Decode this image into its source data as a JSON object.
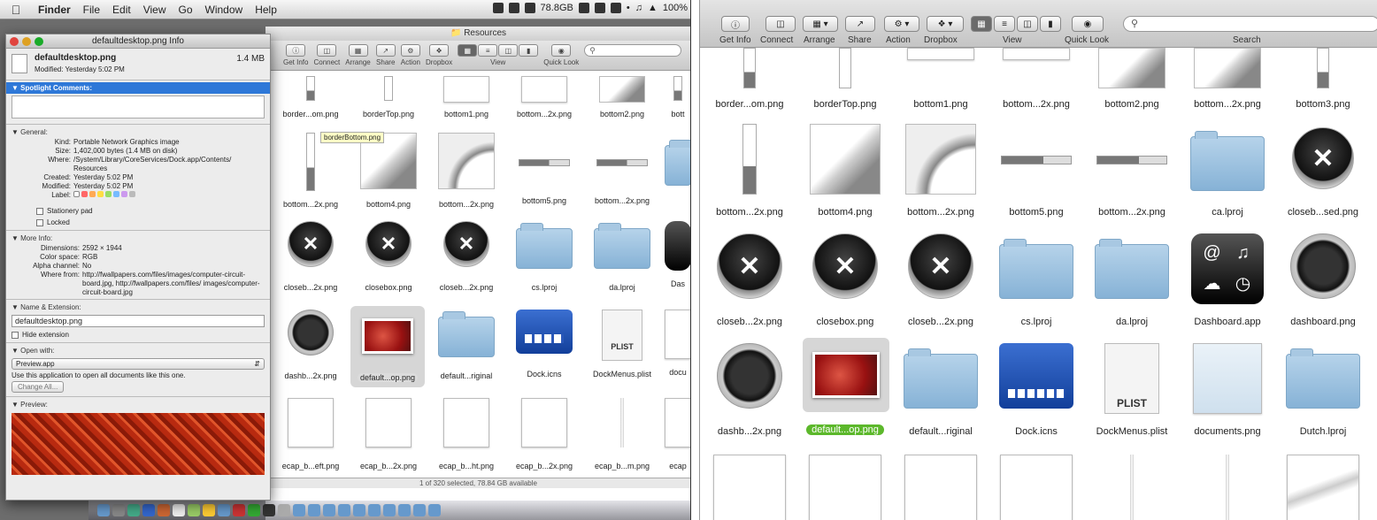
{
  "menubar": {
    "app": "Finder",
    "items": [
      "File",
      "Edit",
      "View",
      "Go",
      "Window",
      "Help"
    ],
    "disk": "78.8GB",
    "battery": "100%"
  },
  "finder": {
    "title": "Resources",
    "toolbar": [
      "Get Info",
      "Connect",
      "Arrange",
      "Share",
      "Action",
      "Dropbox",
      "View",
      "Quick Look"
    ],
    "status": "1 of 320 selected, 78.84 GB available",
    "tooltip": "borderBottom.png",
    "items": [
      [
        "border...om.png",
        "borderTop.png",
        "bottom1.png",
        "bottom...2x.png",
        "bottom2.png",
        "bott"
      ],
      [
        "bottom...2x.png",
        "bottom4.png",
        "bottom...2x.png",
        "bottom5.png",
        "bottom...2x.png",
        ""
      ],
      [
        "closeb...2x.png",
        "closebox.png",
        "closeb...2x.png",
        "cs.lproj",
        "da.lproj",
        "Das"
      ],
      [
        "dashb...2x.png",
        "default...op.png",
        "default...riginal",
        "Dock.icns",
        "DockMenus.plist",
        "docu"
      ],
      [
        "ecap_b...eft.png",
        "ecap_b...2x.png",
        "ecap_b...ht.png",
        "ecap_b...2x.png",
        "ecap_b...m.png",
        "ecap"
      ]
    ]
  },
  "info": {
    "title": "defaultdesktop.png Info",
    "name": "defaultdesktop.png",
    "size": "1.4 MB",
    "modified": "Modified: Yesterday 5:02 PM",
    "spotlight": "Spotlight Comments:",
    "general_h": "General:",
    "general": [
      [
        "Kind:",
        "Portable Network Graphics image"
      ],
      [
        "Size:",
        "1,402,000 bytes (1.4 MB on disk)"
      ],
      [
        "Where:",
        "/System/Library/CoreServices/Dock.app/Contents/ Resources"
      ],
      [
        "Created:",
        "Yesterday 5:02 PM"
      ],
      [
        "Modified:",
        "Yesterday 5:02 PM"
      ],
      [
        "Label:",
        ""
      ]
    ],
    "stationery": "Stationery pad",
    "locked": "Locked",
    "more_h": "More Info:",
    "more": [
      [
        "Dimensions:",
        "2592 × 1944"
      ],
      [
        "Color space:",
        "RGB"
      ],
      [
        "Alpha channel:",
        "No"
      ],
      [
        "Where from:",
        "http://fwallpapers.com/files/images/computer-circuit-board.jpg, http://fwallpapers.com/files/ images/computer-circuit-board.jpg"
      ]
    ],
    "name_h": "Name & Extension:",
    "name_value": "defaultdesktop.png",
    "hide_ext": "Hide extension",
    "open_h": "Open with:",
    "open_app": "Preview.app",
    "open_note": "Use this application to open all documents like this one.",
    "change_all": "Change All...",
    "preview_h": "Preview:"
  },
  "zoom": {
    "toolbar": [
      "Get Info",
      "Connect",
      "Arrange",
      "Share",
      "Action",
      "Dropbox",
      "View",
      "Quick Look",
      "Search"
    ],
    "items": [
      [
        "border...om.png",
        "borderTop.png",
        "bottom1.png",
        "bottom...2x.png",
        "bottom2.png",
        "bottom...2x.png",
        "bottom3.png"
      ],
      [
        "bottom...2x.png",
        "bottom4.png",
        "bottom...2x.png",
        "bottom5.png",
        "bottom...2x.png",
        "ca.lproj",
        "closeb...sed.png"
      ],
      [
        "closeb...2x.png",
        "closebox.png",
        "closeb...2x.png",
        "cs.lproj",
        "da.lproj",
        "Dashboard.app",
        "dashboard.png"
      ],
      [
        "dashb...2x.png",
        "default...op.png",
        "default...riginal",
        "Dock.icns",
        "DockMenus.plist",
        "documents.png",
        "Dutch.lproj"
      ]
    ],
    "plist_text": "PLIST"
  }
}
